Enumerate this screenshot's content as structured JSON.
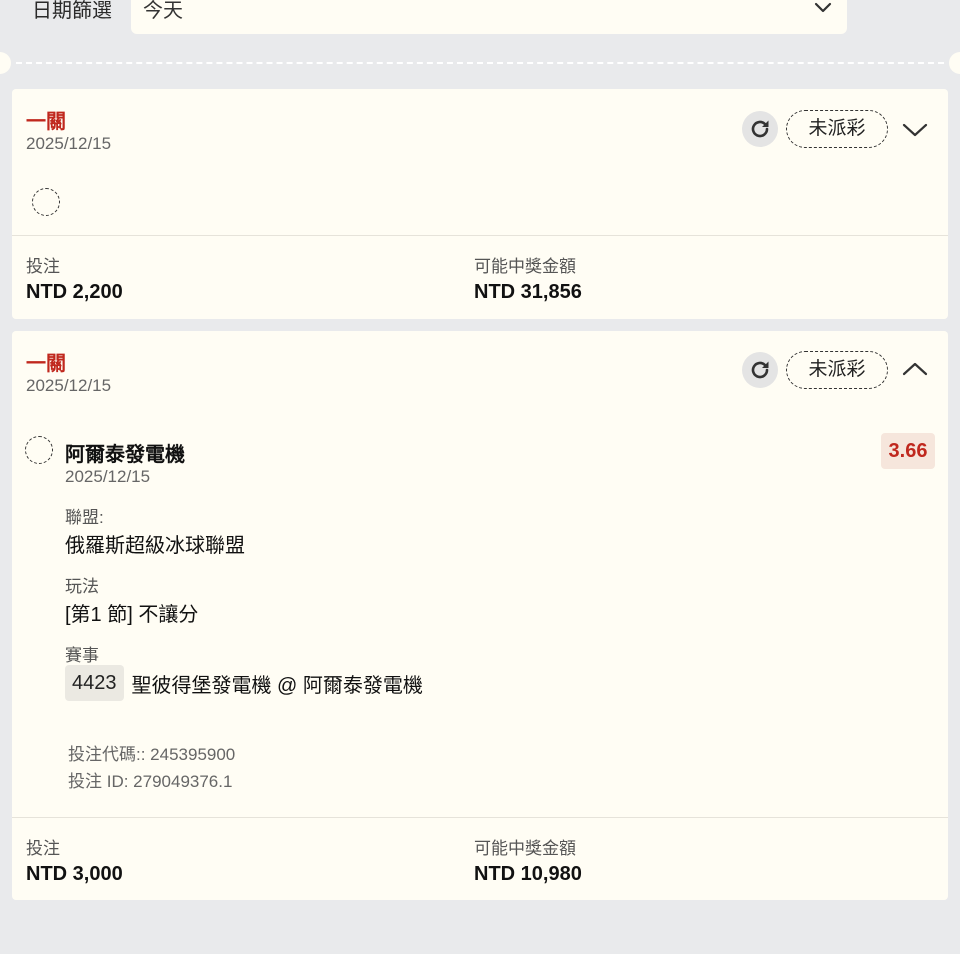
{
  "filter": {
    "label": "日期篩選",
    "value": "今天"
  },
  "bets": [
    {
      "bet_type": "一關",
      "date": "2025/12/15",
      "status": "未派彩",
      "expanded": false,
      "stake_label": "投注",
      "stake_value": "NTD 2,200",
      "win_label": "可能中獎金額",
      "win_value": "NTD 31,856"
    },
    {
      "bet_type": "一關",
      "date": "2025/12/15",
      "status": "未派彩",
      "expanded": true,
      "selection": {
        "team": "阿爾泰發電機",
        "date": "2025/12/15",
        "odds": "3.66",
        "league_label": "聯盟:",
        "league_value": "俄羅斯超級冰球聯盟",
        "market_label": "玩法",
        "market_value": "[第1 節] 不讓分",
        "event_label": "賽事",
        "event_code": "4423",
        "event_name": "聖彼得堡發電機 @ 阿爾泰發電機"
      },
      "bet_code_line": "投注代碼:: 245395900",
      "bet_id_line": "投注 ID: 279049376.1",
      "stake_label": "投注",
      "stake_value": "NTD 3,000",
      "win_label": "可能中獎金額",
      "win_value": "NTD 10,980"
    }
  ],
  "icons": {
    "filter_dropdown": "chevron-down-icon",
    "refresh": "refresh-icon",
    "collapse": "chevron-up-icon",
    "expand": "chevron-down-icon",
    "pending": "pending-circle-icon"
  },
  "colors": {
    "accent_red": "#c0281e",
    "card_bg": "#fffdf4",
    "page_bg": "#e9eaec",
    "odds_bg": "#f6e6dc"
  }
}
